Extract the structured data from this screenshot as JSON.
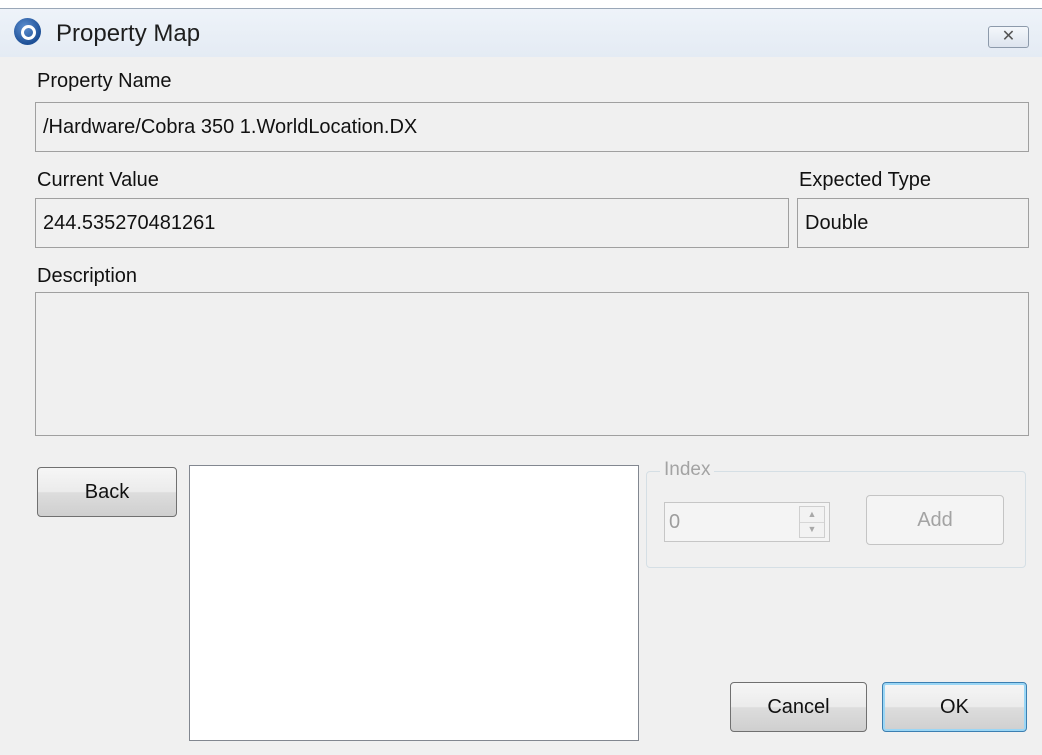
{
  "window": {
    "title": "Property Map",
    "close_glyph": "✕"
  },
  "property_name": {
    "label": "Property Name",
    "value": "/Hardware/Cobra 350 1.WorldLocation.DX"
  },
  "current_value": {
    "label": "Current Value",
    "value": "244.535270481261"
  },
  "expected_type": {
    "label": "Expected Type",
    "value": "Double"
  },
  "description": {
    "label": "Description",
    "value": ""
  },
  "buttons": {
    "back": "Back",
    "cancel": "Cancel",
    "ok": "OK"
  },
  "index_group": {
    "legend": "Index",
    "value": "0",
    "up_glyph": "▲",
    "down_glyph": "▼",
    "add_label": "Add",
    "enabled": false
  },
  "icons": {
    "app": "app-logo-icon",
    "close": "close-icon",
    "spin_up": "chevron-up-icon",
    "spin_down": "chevron-down-icon"
  }
}
